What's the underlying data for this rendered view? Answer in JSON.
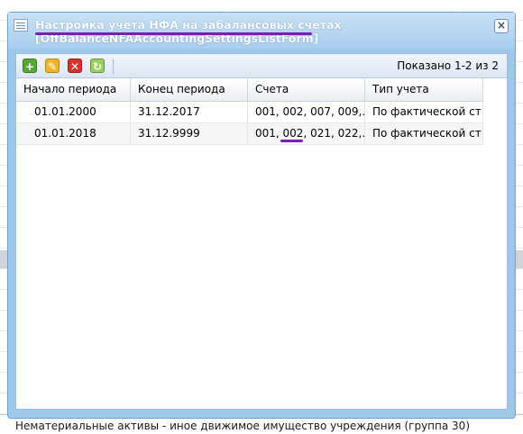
{
  "background": {
    "footer_text": "Нематериальные активы - иное движимое имущество учреждения (группа 30)"
  },
  "window": {
    "title": "Настройка учета НФА на забалансовых счетах [OffBalanceNFAAccountingSettingsListForm]",
    "close_glyph": "×"
  },
  "toolbar": {
    "add_glyph": "+",
    "edit_glyph": "✎",
    "delete_glyph": "✕",
    "refresh_glyph": "↻",
    "paging_text": "Показано 1-2 из 2"
  },
  "grid": {
    "columns": [
      "Начало периода",
      "Конец периода",
      "Счета",
      "Тип учета"
    ],
    "rows": [
      {
        "start": "01.01.2000",
        "end": "31.12.2017",
        "accounts": "001, 002, 007, 009,...",
        "type": "По фактической ст..."
      },
      {
        "start": "01.01.2018",
        "end": "31.12.9999",
        "accounts": "001, 002, 021, 022,...",
        "type": "По фактической ст..."
      }
    ]
  },
  "colors": {
    "annotation": "#7a1fb0",
    "window_frame": "#9fc7ea"
  }
}
